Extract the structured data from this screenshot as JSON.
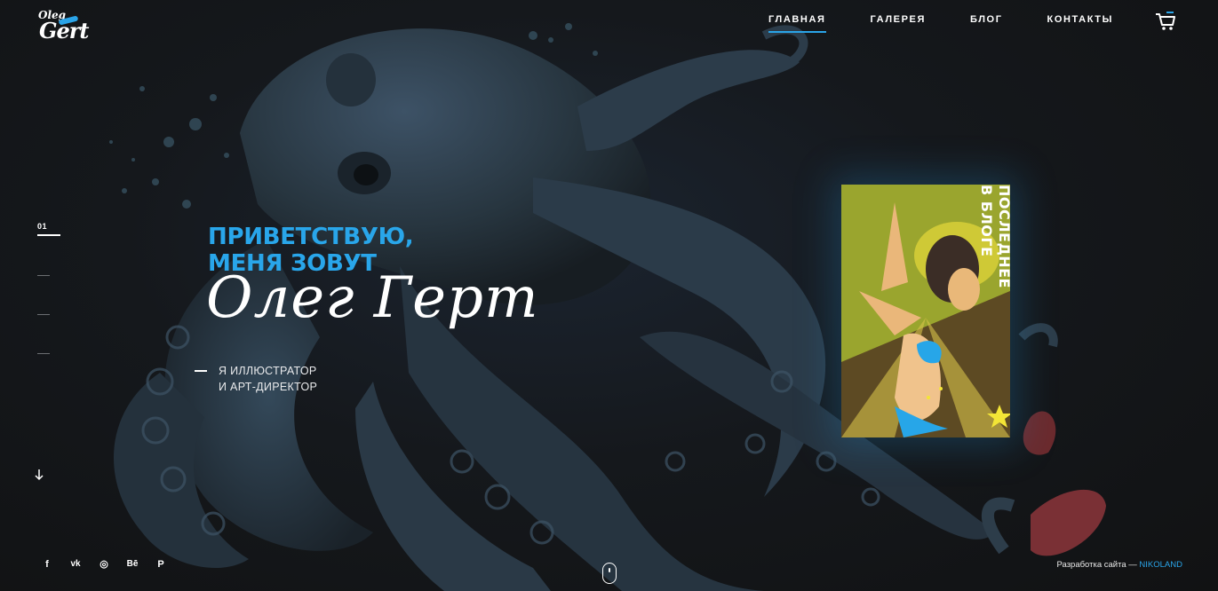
{
  "logo": {
    "line1": "Oleg",
    "line2": "Gert"
  },
  "nav": {
    "items": [
      {
        "label": "ГЛАВНАЯ",
        "active": true
      },
      {
        "label": "ГАЛЕРЕЯ",
        "active": false
      },
      {
        "label": "БЛОГ",
        "active": false
      },
      {
        "label": "КОНТАКТЫ",
        "active": false
      }
    ],
    "cart_icon": "cart-icon"
  },
  "slider": {
    "current": "01",
    "total_markers": 4
  },
  "hero": {
    "greeting_line1": "ПРИВЕТСТВУЮ,",
    "greeting_line2": "МЕНЯ ЗОВУТ",
    "name": "Олег Герт",
    "role_line1": "Я ИЛЛЮСТРАТОР",
    "role_line2": "И АРТ-ДИРЕКТОР"
  },
  "blog": {
    "label_line1": "ПОСЛЕДНЕЕ",
    "label_line2": "В БЛОГЕ"
  },
  "social": [
    {
      "name": "facebook-icon",
      "glyph": "f"
    },
    {
      "name": "vk-icon",
      "glyph": "vk"
    },
    {
      "name": "instagram-icon",
      "glyph": "◎"
    },
    {
      "name": "behance-icon",
      "glyph": "Bē"
    },
    {
      "name": "pinterest-icon",
      "glyph": "P"
    }
  ],
  "footer": {
    "credit_text": "Разработка сайта — ",
    "credit_link": "NIKOLAND"
  },
  "colors": {
    "accent": "#29a6ea",
    "background": "#121314",
    "octopus": "#2b3a48"
  }
}
